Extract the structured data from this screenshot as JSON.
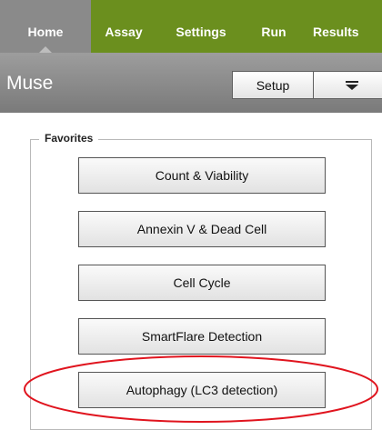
{
  "nav": {
    "tabs": [
      {
        "label": "Home",
        "active": true
      },
      {
        "label": "Assay"
      },
      {
        "label": "Settings"
      },
      {
        "label": "Run"
      },
      {
        "label": "Results"
      }
    ]
  },
  "header": {
    "title": "Muse",
    "setup_label": "Setup",
    "menu_icon": "menu-dropdown-icon"
  },
  "favorites": {
    "legend": "Favorites",
    "buttons": [
      "Count & Viability",
      "Annexin V & Dead Cell",
      "Cell Cycle",
      "SmartFlare Detection",
      "Autophagy (LC3 detection)"
    ]
  },
  "annotation": {
    "highlight_color": "#e0141e",
    "highlighted_button": "Autophagy (LC3 detection)"
  },
  "colors": {
    "nav_bg": "#6b8f1e",
    "nav_active_bg": "#8a8a8a",
    "titlebar_bg": "#8c8c8c"
  }
}
